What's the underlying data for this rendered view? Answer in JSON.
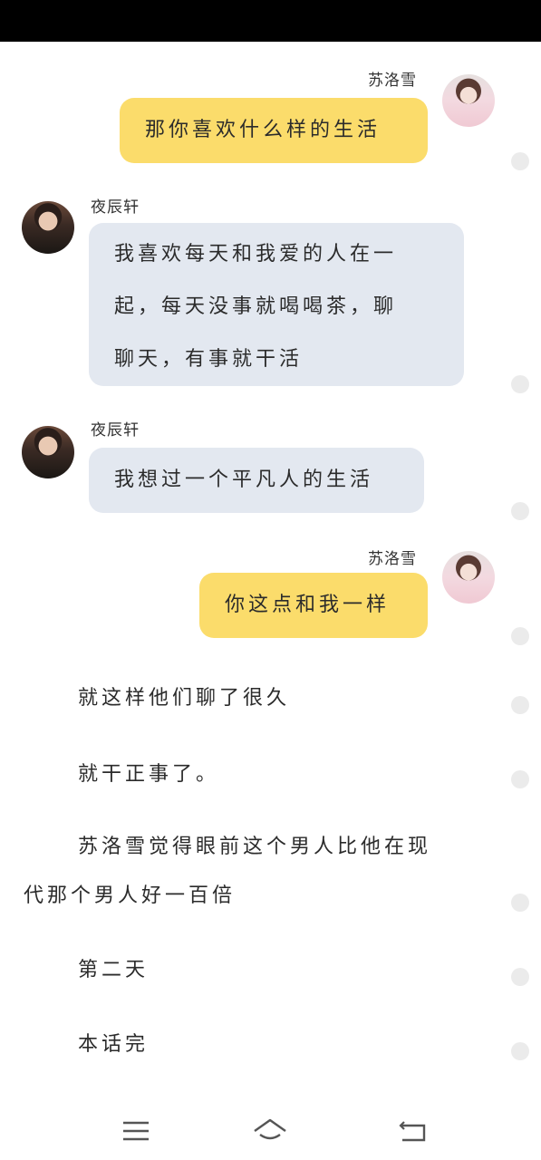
{
  "chat": {
    "msg1": {
      "sender": "苏洛雪",
      "text": "那你喜欢什么样的生活"
    },
    "msg2": {
      "sender": "夜辰轩",
      "lines": [
        "我喜欢每天和我爱的人在一",
        "起，每天没事就喝喝茶，聊",
        "聊天，有事就干活"
      ]
    },
    "msg3": {
      "sender": "夜辰轩",
      "text": "我想过一个平凡人的生活"
    },
    "msg4": {
      "sender": "苏洛雪",
      "text": "你这点和我一样"
    }
  },
  "story": {
    "p1": "就这样他们聊了很久",
    "p2": "就干正事了。",
    "p3_line1": "苏洛雪觉得眼前这个男人比他在现",
    "p3_line2": "代那个男人好一百倍",
    "p4": "第二天",
    "p5": "本话完"
  },
  "icons": {
    "menu": "menu-icon",
    "home": "home-icon",
    "back": "back-icon"
  },
  "colors": {
    "yellow_bubble": "#fbdc6b",
    "gray_bubble": "#e3e8f0"
  }
}
